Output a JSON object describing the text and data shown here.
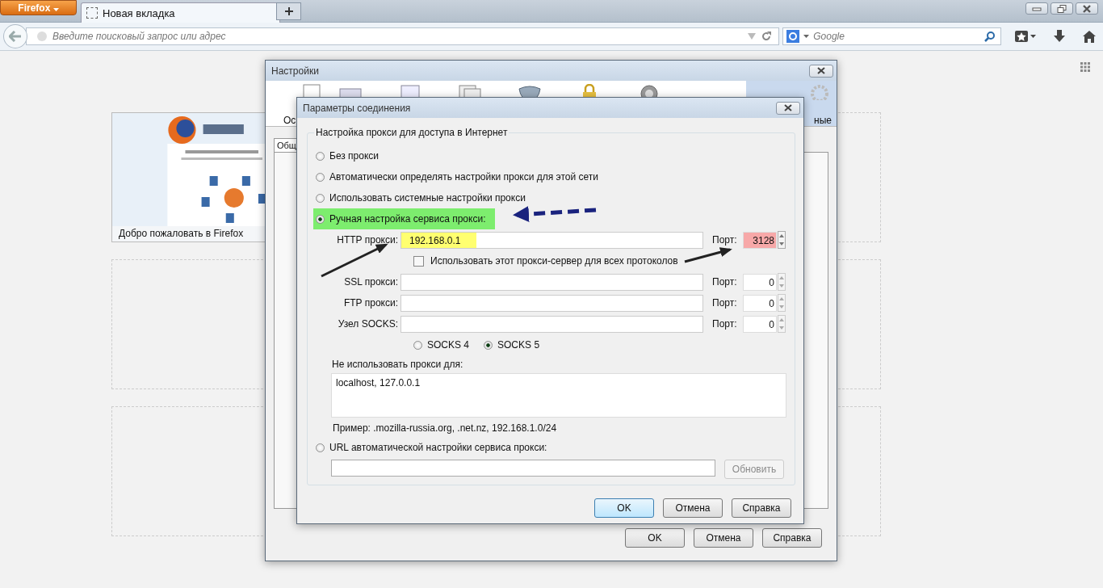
{
  "browser": {
    "menu_button": "Firefox",
    "tabs": [
      {
        "label": "Новая вкладка",
        "selected": true
      }
    ],
    "address_placeholder": "Введите поисковый запрос или адрес",
    "search_placeholder": "Google"
  },
  "new_tab_page": {
    "thumbnail_caption": "Добро пожаловать в Firefox"
  },
  "settings_window": {
    "title": "Настройки",
    "toolbar_tabs": [
      {
        "label": "Ос",
        "selected": false
      },
      {
        "selected": false
      },
      {
        "selected": false
      },
      {
        "selected": false
      },
      {
        "selected": false
      },
      {
        "selected": false
      },
      {
        "selected": false
      },
      {
        "label": "ные",
        "selected": true
      }
    ],
    "panel_tab": "Общ",
    "buttons": [
      "OK",
      "Отмена",
      "Справка"
    ]
  },
  "connection_dialog": {
    "title": "Параметры соединения",
    "group_title": "Настройка прокси для доступа в Интернет",
    "modes": [
      {
        "label": "Без прокси",
        "selected": false,
        "highlighted": false
      },
      {
        "label": "Автоматически определять настройки прокси для этой сети",
        "selected": false,
        "highlighted": false
      },
      {
        "label": "Использовать системные настройки прокси",
        "selected": false,
        "highlighted": false
      },
      {
        "label": "Ручная настройка сервиса прокси:",
        "selected": true,
        "highlighted": true
      }
    ],
    "http": {
      "label": "HTTP прокси:",
      "value": "192.168.0.1",
      "port_label": "Порт:",
      "port": "3128",
      "highlighted": true
    },
    "share_all": {
      "label": "Использовать этот прокси-сервер для всех протоколов",
      "checked": false
    },
    "proxies": [
      {
        "label": "SSL прокси:",
        "port_label": "Порт:",
        "port": "0"
      },
      {
        "label": "FTP прокси:",
        "port_label": "Порт:",
        "port": "0"
      },
      {
        "label": "Узел SOCKS:",
        "port_label": "Порт:",
        "port": "0"
      }
    ],
    "socks_versions": [
      {
        "label": "SOCKS 4",
        "selected": false
      },
      {
        "label": "SOCKS 5",
        "selected": true
      }
    ],
    "no_proxy_label": "Не использовать прокси для:",
    "no_proxy_value": "localhost, 127.0.0.1",
    "example": "Пример: .mozilla-russia.org, .net.nz, 192.168.1.0/24",
    "auto_url": {
      "label": "URL автоматической настройки сервиса прокси:",
      "selected": false
    },
    "reload_button": {
      "label": "Обновить",
      "disabled": true
    },
    "buttons": [
      {
        "label": "OK",
        "default": true
      },
      {
        "label": "Отмена",
        "default": false
      },
      {
        "label": "Справка",
        "default": false
      }
    ]
  }
}
